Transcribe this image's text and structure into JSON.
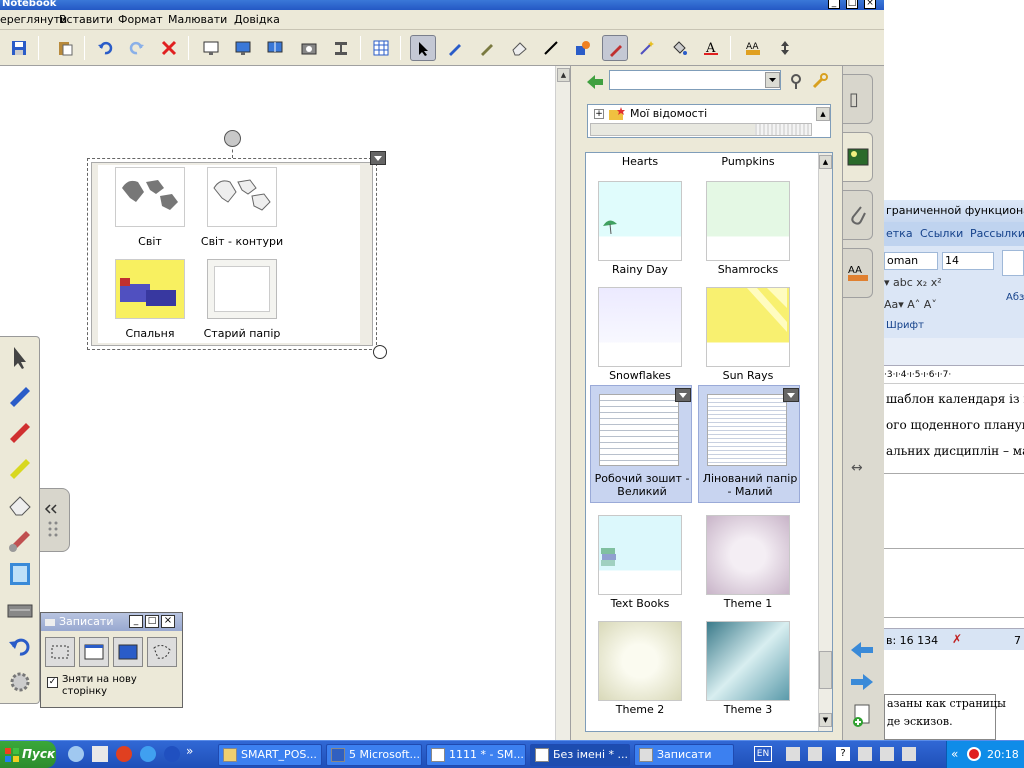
{
  "window": {
    "title": "Notebook"
  },
  "menu": [
    "ереглянути",
    "Вставити",
    "Формат",
    "Малювати",
    "Довідка"
  ],
  "gallery": {
    "search_value": "",
    "tree_item": "Мої відомості",
    "header_labels": [
      "Hearts",
      "Pumpkins"
    ],
    "items": [
      {
        "label": "Rainy Day"
      },
      {
        "label": "Shamrocks"
      },
      {
        "label": "Snowflakes"
      },
      {
        "label": "Sun Rays"
      },
      {
        "label": "Робочий зошит - Великий"
      },
      {
        "label": "Лінований папір - Малий"
      },
      {
        "label": "Text Books"
      },
      {
        "label": "Theme 1"
      },
      {
        "label": "Theme 2"
      },
      {
        "label": "Theme 3"
      }
    ]
  },
  "canvas_object": {
    "items": [
      {
        "label": "Світ"
      },
      {
        "label": "Світ - контури"
      },
      {
        "label": "Спальня"
      },
      {
        "label": "Старий папір"
      }
    ]
  },
  "recorder": {
    "title": "Записати",
    "checkbox_label": "Зняти на нову сторінку",
    "checked": true
  },
  "word": {
    "title_fragment": "граниченной функционал",
    "tabs": [
      "етка",
      "Ссылки",
      "Рассылки"
    ],
    "font_name": "oman",
    "font_size": "14",
    "group_label": "Шрифт",
    "para_label": "Абз",
    "ruler": "·3·ı·4·ı·5·ı·6·ı·7·",
    "lines": [
      "шаблон календаря із в",
      "ого щоденного планува",
      "альних дисциплін – ма"
    ],
    "status": "в: 16 134",
    "status_num": "7",
    "bottom_lines": [
      "азаны как страницы",
      "де эскизов."
    ]
  },
  "taskbar": {
    "start": "Пуск",
    "tasks": [
      "SMART_POS...",
      "5 Microsoft...",
      "1111 * - SM...",
      "Без імені * ...",
      "Записати"
    ],
    "lang": "EN",
    "clock": "20:18"
  }
}
